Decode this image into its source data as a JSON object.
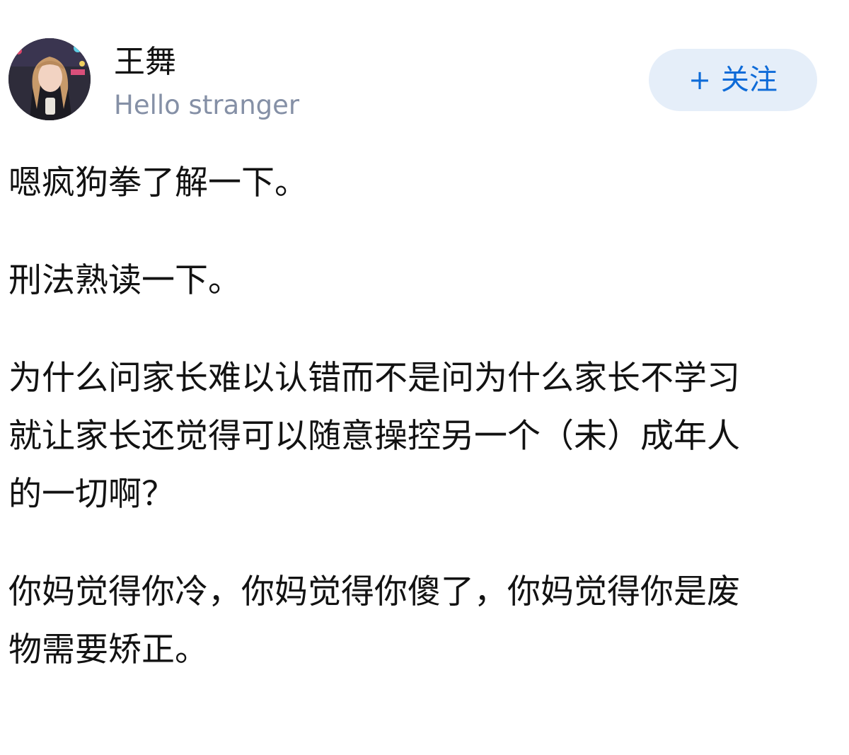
{
  "author": {
    "name": "王舞",
    "bio": "Hello stranger",
    "avatar_icon": "user-avatar-photo"
  },
  "follow_button": {
    "plus": "+",
    "label": "关注",
    "background": "#e5eef9",
    "text_color": "#0e6bd8"
  },
  "content": {
    "paragraphs": [
      {
        "lines": [
          "嗯疯狗拳了解一下。"
        ]
      },
      {
        "lines": [
          "刑法熟读一下。"
        ]
      },
      {
        "lines": [
          "为什么问家长难以认错而不是问为什么家长不学习",
          "就让家长还觉得可以随意操控另一个（未）成年人",
          "的一切啊？"
        ]
      },
      {
        "lines": [
          "你妈觉得你冷，你妈觉得你傻了，你妈觉得你是废",
          "物需要矫正。"
        ]
      }
    ]
  }
}
